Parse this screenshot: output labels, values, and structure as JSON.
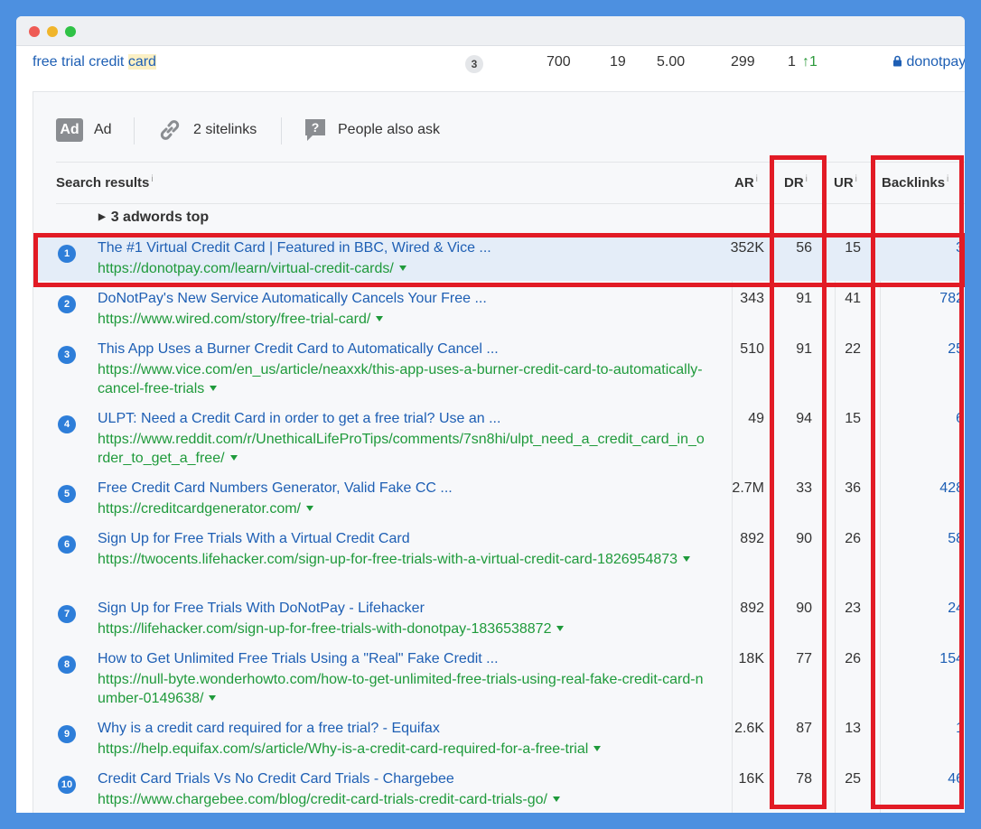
{
  "keyword_row": {
    "keyword_prefix": "free trial credit ",
    "keyword_highlight": "card",
    "serp_features_count": "3",
    "volume": "700",
    "kd": "19",
    "cpc": "5.00",
    "clicks": "299",
    "position": "1",
    "position_change": "1",
    "domain": "donotpay"
  },
  "features": {
    "ad_icon_text": "Ad",
    "ad_label": "Ad",
    "sitelinks_label": "2 sitelinks",
    "paa_label": "People also ask"
  },
  "table_header": {
    "search_results": "Search results",
    "ar": "AR",
    "dr": "DR",
    "ur": "UR",
    "backlinks": "Backlinks",
    "info_mark": "i"
  },
  "adwords_label": "3 adwords top",
  "results": [
    {
      "n": "1",
      "title": "The #1 Virtual Credit Card | Featured in BBC, Wired & Vice ...",
      "url": "https://donotpay.com/learn/virtual-credit-cards/",
      "ar": "352K",
      "dr": "56",
      "ur": "15",
      "backlinks": "3"
    },
    {
      "n": "2",
      "title": "DoNotPay's New Service Automatically Cancels Your Free ...",
      "url": "https://www.wired.com/story/free-trial-card/",
      "ar": "343",
      "dr": "91",
      "ur": "41",
      "backlinks": "782"
    },
    {
      "n": "3",
      "title": "This App Uses a Burner Credit Card to Automatically Cancel ...",
      "url": "https://www.vice.com/en_us/article/neaxxk/this-app-uses-a-burner-credit-card-to-automatically-cancel-free-trials",
      "ar": "510",
      "dr": "91",
      "ur": "22",
      "backlinks": "25"
    },
    {
      "n": "4",
      "title": "ULPT: Need a Credit Card in order to get a free trial? Use an ...",
      "url": "https://www.reddit.com/r/UnethicalLifeProTips/comments/7sn8hi/ulpt_need_a_credit_card_in_order_to_get_a_free/",
      "ar": "49",
      "dr": "94",
      "ur": "15",
      "backlinks": "6"
    },
    {
      "n": "5",
      "title": "Free Credit Card Numbers Generator, Valid Fake CC ...",
      "url": "https://creditcardgenerator.com/",
      "ar": "2.7M",
      "dr": "33",
      "ur": "36",
      "backlinks": "428"
    },
    {
      "n": "6",
      "title": "Sign Up for Free Trials With a Virtual Credit Card",
      "url": "https://twocents.lifehacker.com/sign-up-for-free-trials-with-a-virtual-credit-card-1826954873",
      "ar": "892",
      "dr": "90",
      "ur": "26",
      "backlinks": "58"
    },
    {
      "n": "7",
      "title": "Sign Up for Free Trials With DoNotPay - Lifehacker",
      "url": "https://lifehacker.com/sign-up-for-free-trials-with-donotpay-1836538872",
      "ar": "892",
      "dr": "90",
      "ur": "23",
      "backlinks": "24"
    },
    {
      "n": "8",
      "title": "How to Get Unlimited Free Trials Using a \"Real\" Fake Credit ...",
      "url": "https://null-byte.wonderhowto.com/how-to-get-unlimited-free-trials-using-real-fake-credit-card-number-0149638/",
      "ar": "18K",
      "dr": "77",
      "ur": "26",
      "backlinks": "154"
    },
    {
      "n": "9",
      "title": "Why is a credit card required for a free trial? - Equifax",
      "url": "https://help.equifax.com/s/article/Why-is-a-credit-card-required-for-a-free-trial",
      "ar": "2.6K",
      "dr": "87",
      "ur": "13",
      "backlinks": "1"
    },
    {
      "n": "10",
      "title": "Credit Card Trials Vs No Credit Card Trials - Chargebee",
      "url": "https://www.chargebee.com/blog/credit-card-trials-credit-card-trials-go/",
      "ar": "16K",
      "dr": "78",
      "ur": "25",
      "backlinks": "46"
    }
  ],
  "colors": {
    "highlight_red": "#e21b25",
    "link_blue": "#1e5fb4",
    "url_green": "#1f9a3b",
    "badge_blue": "#2e7ed9",
    "background_blue": "#4d90e0"
  }
}
